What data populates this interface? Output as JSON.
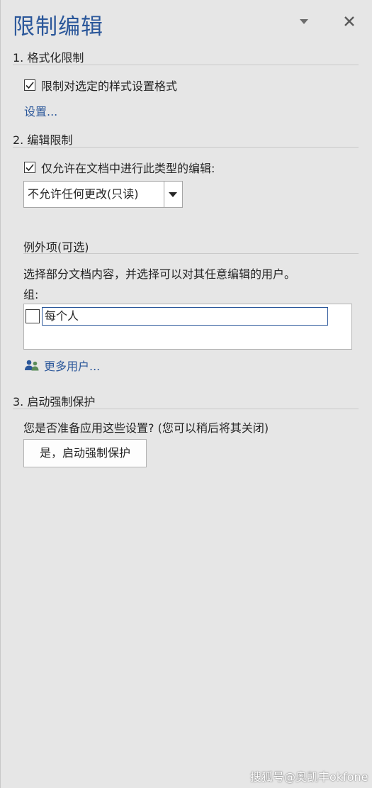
{
  "pane": {
    "title": "限制编辑",
    "menu_icon": "dropdown-triangle-icon",
    "close_icon": "close-icon"
  },
  "section1": {
    "heading": "1. 格式化限制",
    "checkbox_label": "限制对选定的样式设置格式",
    "checkbox_checked": true,
    "settings_link": "设置..."
  },
  "section2": {
    "heading": "2. 编辑限制",
    "checkbox_label": "仅允许在文档中进行此类型的编辑:",
    "checkbox_checked": true,
    "dropdown_value": "不允许任何更改(只读)",
    "exceptions_heading": "例外项(可选)",
    "exceptions_desc": "选择部分文档内容，并选择可以对其任意编辑的用户。",
    "groups_label": "组:",
    "groups": [
      {
        "name": "每个人",
        "checked": false
      }
    ],
    "more_users_link": "更多用户...",
    "more_users_icon": "users-icon"
  },
  "section3": {
    "heading": "3. 启动强制保护",
    "question": "您是否准备应用这些设置? (您可以稍后将其关闭)",
    "button_label": "是，启动强制保护"
  },
  "watermark": "搜狐号@奥凯丰okfone",
  "colors": {
    "accent": "#2b579a",
    "background": "#e6e6e6"
  }
}
